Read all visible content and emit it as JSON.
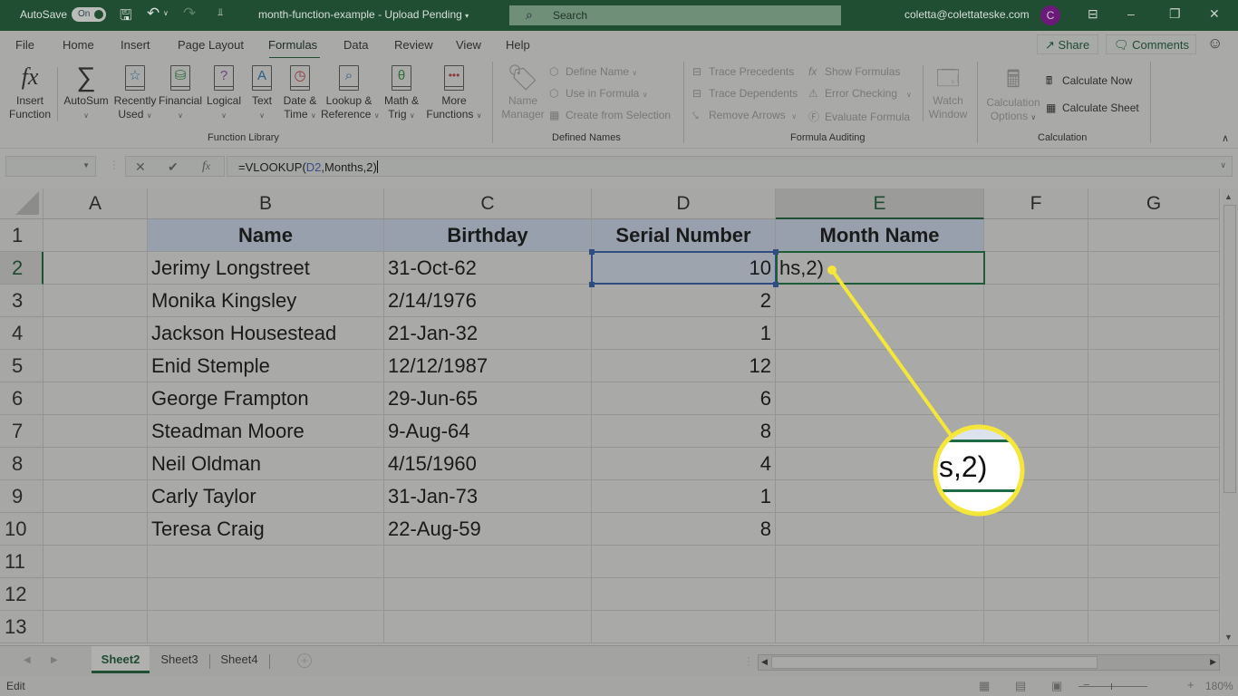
{
  "titlebar": {
    "autosave_label": "AutoSave",
    "autosave_state": "On",
    "doc_title": "month-function-example",
    "doc_status": "Upload Pending",
    "search_placeholder": "Search",
    "user_email": "coletta@colettateske.com",
    "avatar_initial": "C",
    "icons": [
      "save-icon",
      "undo-icon",
      "redo-icon",
      "customize-qat-icon",
      "search-icon",
      "ribbon-display-icon",
      "minimize-icon",
      "restore-icon",
      "close-icon"
    ]
  },
  "menu": {
    "tabs": [
      "File",
      "Home",
      "Insert",
      "Page Layout",
      "Formulas",
      "Data",
      "Review",
      "View",
      "Help"
    ],
    "active": "Formulas",
    "share_label": "Share",
    "comments_label": "Comments"
  },
  "ribbon": {
    "function_library": {
      "label": "Function Library",
      "insert_function": [
        "Insert",
        "Function"
      ],
      "buttons": [
        {
          "line1": "AutoSum",
          "line2": "",
          "icon": "sigma"
        },
        {
          "line1": "Recently",
          "line2": "Used",
          "icon": "star"
        },
        {
          "line1": "Financial",
          "line2": "",
          "icon": "coins"
        },
        {
          "line1": "Logical",
          "line2": "",
          "icon": "?"
        },
        {
          "line1": "Text",
          "line2": "",
          "icon": "A"
        },
        {
          "line1": "Date &",
          "line2": "Time",
          "icon": "clock"
        },
        {
          "line1": "Lookup &",
          "line2": "Reference",
          "icon": "magnifier"
        },
        {
          "line1": "Math &",
          "line2": "Trig",
          "icon": "θ"
        },
        {
          "line1": "More",
          "line2": "Functions",
          "icon": "..."
        }
      ]
    },
    "defined_names": {
      "label": "Defined Names",
      "name_manager": [
        "Name",
        "Manager"
      ],
      "define_name": "Define Name",
      "use_in_formula": "Use in Formula",
      "create_from_selection": "Create from Selection"
    },
    "formula_auditing": {
      "label": "Formula Auditing",
      "trace_precedents": "Trace Precedents",
      "trace_dependents": "Trace Dependents",
      "remove_arrows": "Remove Arrows",
      "show_formulas": "Show Formulas",
      "error_checking": "Error Checking",
      "evaluate_formula": "Evaluate Formula",
      "watch_window": [
        "Watch",
        "Window"
      ]
    },
    "calculation": {
      "label": "Calculation",
      "calculation_options": [
        "Calculation",
        "Options"
      ],
      "calculate_now": "Calculate Now",
      "calculate_sheet": "Calculate Sheet"
    }
  },
  "formula_bar": {
    "name_box": "",
    "formula_prefix": "=VLOOKUP(",
    "formula_ref": "D2",
    "formula_suffix": ",Months,2)"
  },
  "sheet": {
    "columns": [
      "A",
      "B",
      "C",
      "D",
      "E",
      "F",
      "G"
    ],
    "selected_column": "E",
    "rows": [
      "1",
      "2",
      "3",
      "4",
      "5",
      "6",
      "7",
      "8",
      "9",
      "10",
      "11",
      "12",
      "13"
    ],
    "selected_row": "2",
    "headers": {
      "B": "Name",
      "C": "Birthday",
      "D": "Serial Number",
      "E": "Month Name"
    },
    "data": [
      {
        "name": "Jerimy Longstreet",
        "birthday": "31-Oct-62",
        "serial": "10",
        "month": "hs,2)"
      },
      {
        "name": "Monika Kingsley",
        "birthday": "2/14/1976",
        "serial": "2",
        "month": ""
      },
      {
        "name": "Jackson Housestead",
        "birthday": "21-Jan-32",
        "serial": "1",
        "month": ""
      },
      {
        "name": "Enid Stemple",
        "birthday": "12/12/1987",
        "serial": "12",
        "month": ""
      },
      {
        "name": "George Frampton",
        "birthday": "29-Jun-65",
        "serial": "6",
        "month": ""
      },
      {
        "name": "Steadman Moore",
        "birthday": "9-Aug-64",
        "serial": "8",
        "month": ""
      },
      {
        "name": "Neil Oldman",
        "birthday": "4/15/1960",
        "serial": "4",
        "month": ""
      },
      {
        "name": "Carly Taylor",
        "birthday": "31-Jan-73",
        "serial": "1",
        "month": ""
      },
      {
        "name": "Teresa Craig",
        "birthday": "22-Aug-59",
        "serial": "8",
        "month": ""
      }
    ]
  },
  "callout": {
    "magnified_text": "s,2)",
    "color": "#f5e63a"
  },
  "sheet_tabs": {
    "tabs": [
      "Sheet2",
      "Sheet3",
      "Sheet4"
    ],
    "active": "Sheet2"
  },
  "status": {
    "mode": "Edit",
    "zoom": "180%"
  }
}
